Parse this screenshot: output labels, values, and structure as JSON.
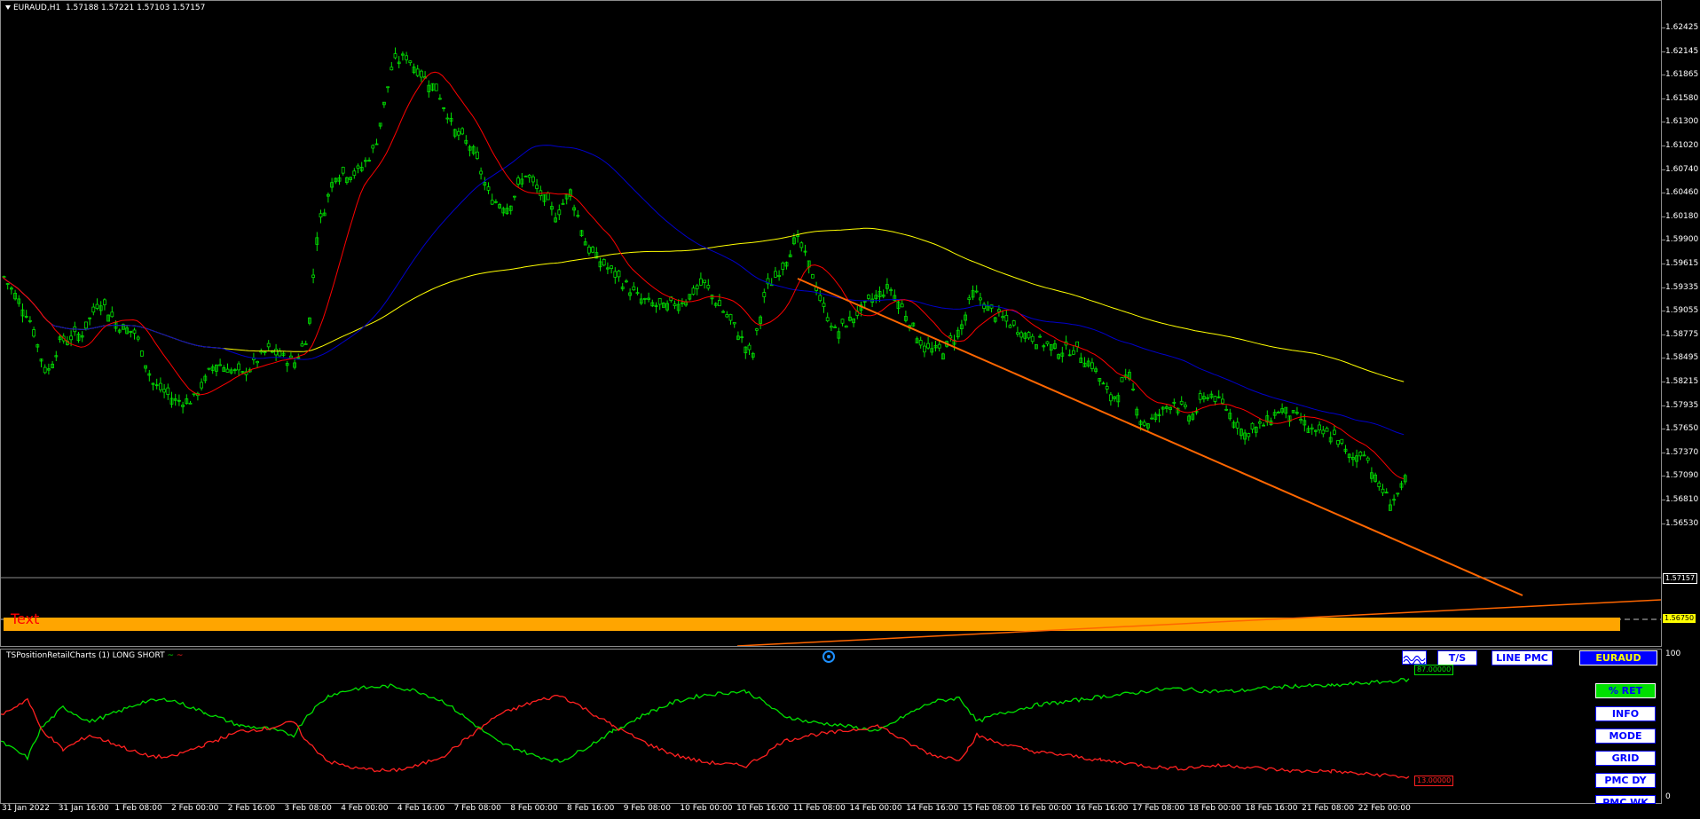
{
  "chart": {
    "symbol": "EURAUD,H1",
    "ohlc": "1.57188 1.57221 1.57103 1.57157",
    "text_object": "Text"
  },
  "price_scale": [
    "1.62425",
    "1.62145",
    "1.61865",
    "1.61580",
    "1.61300",
    "1.61020",
    "1.60740",
    "1.60460",
    "1.60180",
    "1.59900",
    "1.59615",
    "1.59335",
    "1.59055",
    "1.58775",
    "1.58495",
    "1.58215",
    "1.57935",
    "1.57650",
    "1.57370",
    "1.57090",
    "1.56810",
    "1.56530"
  ],
  "price_marks": {
    "current": "1.57157",
    "level": "1.56750"
  },
  "time_scale": [
    "31 Jan 2022",
    "31 Jan 16:00",
    "1 Feb 08:00",
    "2 Feb 00:00",
    "2 Feb 16:00",
    "3 Feb 08:00",
    "4 Feb 00:00",
    "4 Feb 16:00",
    "7 Feb 08:00",
    "8 Feb 00:00",
    "8 Feb 16:00",
    "9 Feb 08:00",
    "10 Feb 00:00",
    "10 Feb 16:00",
    "11 Feb 08:00",
    "14 Feb 00:00",
    "14 Feb 16:00",
    "15 Feb 08:00",
    "16 Feb 00:00",
    "16 Feb 16:00",
    "17 Feb 08:00",
    "18 Feb 00:00",
    "18 Feb 16:00",
    "21 Feb 08:00",
    "22 Feb 00:00"
  ],
  "indicator": {
    "title": "TSPositionRetailCharts (1) LONG SHORT",
    "legend_long": "~",
    "legend_short": "~",
    "scale_top": "100",
    "scale_bottom": "0",
    "long_value": "87.00000",
    "short_value": "13.00000",
    "buttons": {
      "ts": "T/S",
      "line_pmc": "LINE PMC",
      "symbol": "EURAUD",
      "pct_ret": "% RET",
      "info": "INFO",
      "mode": "MODE",
      "grid": "GRID",
      "pmc_dy": "PMC DY",
      "partial": "PMC WK"
    }
  },
  "colors": {
    "bull_candle": "#00e000",
    "ma_fast": "#ff0000",
    "ma_mid": "#0000cc",
    "ma_slow": "#ffff00",
    "trendline": "#ff6600",
    "zone": "#ffa500",
    "long": "#00e000",
    "short": "#ff2020"
  }
}
